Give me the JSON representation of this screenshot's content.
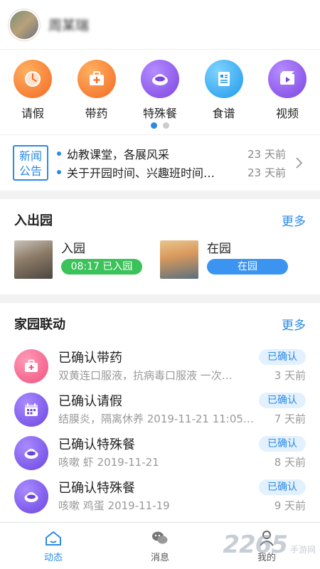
{
  "header": {
    "username": "周某瑞"
  },
  "quick_menu": [
    {
      "label": "请假",
      "icon": "clock-icon",
      "color": "#f7772f"
    },
    {
      "label": "带药",
      "icon": "medicine-box-icon",
      "color": "#f7772f"
    },
    {
      "label": "特殊餐",
      "icon": "special-meal-icon",
      "color": "#8e55e8"
    },
    {
      "label": "食谱",
      "icon": "recipe-icon",
      "color": "#2fa8f0"
    },
    {
      "label": "视频",
      "icon": "video-icon",
      "color": "#8e55e8"
    }
  ],
  "pager": {
    "pages": 2,
    "active": 1
  },
  "news": {
    "badge_line1": "新闻",
    "badge_line2": "公告",
    "items": [
      {
        "text": "幼教课堂，各展风采",
        "time": "23 天前"
      },
      {
        "text": "关于开园时间、兴趣班时间…",
        "time": "23 天前"
      }
    ]
  },
  "inout": {
    "title": "入出园",
    "more": "更多",
    "cards": [
      {
        "title": "入园",
        "status": "08:17 已入园",
        "color": "#3bc25a"
      },
      {
        "title": "在园",
        "status": "在园",
        "color": "#3b95f0"
      }
    ]
  },
  "activity": {
    "title": "家园联动",
    "more": "更多",
    "items": [
      {
        "title": "已确认带药",
        "sub": "双黄连口服液，抗病毒口服液 一次…",
        "badge": "已确认",
        "time": "3 天前",
        "icon": "medicine-box-icon"
      },
      {
        "title": "已确认请假",
        "sub": "结膜炎，隔离休养 2019-11-21 11:05…",
        "badge": "已确认",
        "time": "7 天前",
        "icon": "calendar-icon"
      },
      {
        "title": "已确认特殊餐",
        "sub": "咳嗽 虾 2019-11-21",
        "badge": "已确认",
        "time": "8 天前",
        "icon": "special-meal-icon"
      },
      {
        "title": "已确认特殊餐",
        "sub": "咳嗽 鸡蛋 2019-11-19",
        "badge": "已确认",
        "time": "9 天前",
        "icon": "special-meal-icon"
      }
    ]
  },
  "tabbar": [
    {
      "label": "动态",
      "icon": "home-icon",
      "active": true
    },
    {
      "label": "消息",
      "icon": "chat-icon",
      "active": false
    },
    {
      "label": "我的",
      "icon": "user-icon",
      "active": false
    }
  ],
  "watermark": {
    "big": "2265",
    "small": "手游网"
  },
  "colors": {
    "accent": "#2a8ae6"
  }
}
